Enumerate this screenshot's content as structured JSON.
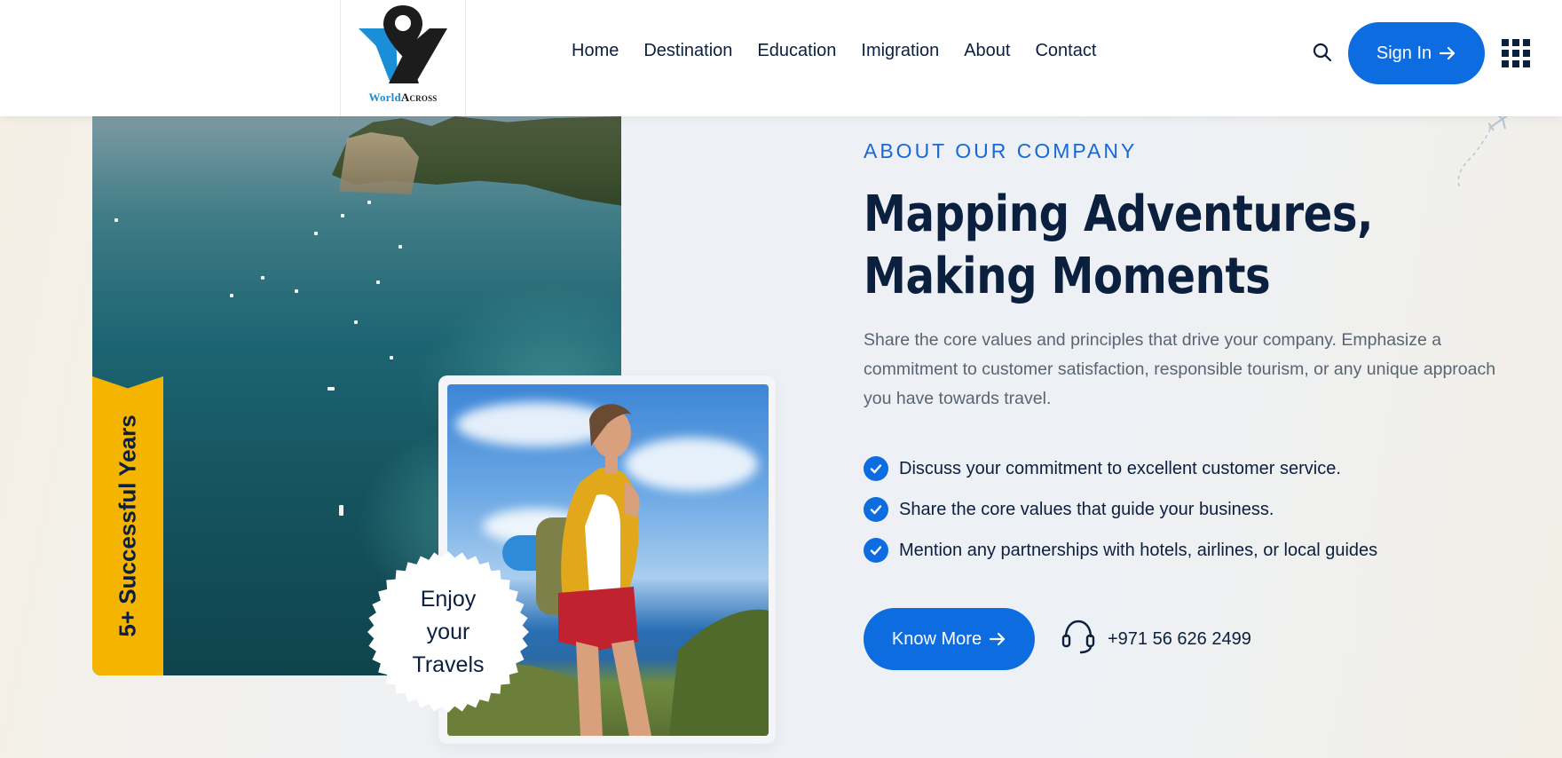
{
  "header": {
    "logo": {
      "word1": "World",
      "word2": "Across"
    },
    "nav": [
      {
        "label": "Home"
      },
      {
        "label": "Destination"
      },
      {
        "label": "Education"
      },
      {
        "label": "Imigration"
      },
      {
        "label": "About"
      },
      {
        "label": "Contact"
      }
    ],
    "sign_in_label": "Sign In",
    "icons": {
      "search": "search-icon",
      "menu": "grid-menu-icon",
      "arrow": "arrow-right-icon"
    }
  },
  "hero": {
    "years_badge": "5+ Successful Years",
    "stamp": [
      "Enjoy",
      "your",
      "Travels"
    ]
  },
  "about": {
    "eyebrow": "ABOUT OUR COMPANY",
    "headline": "Mapping Adventures, Making Moments",
    "description": "Share the core values and principles that drive your company. Emphasize a commitment to customer satisfaction, responsible tourism, or any unique approach you have towards travel.",
    "checklist": [
      "Discuss your commitment to excellent customer service.",
      "Share the core values that guide your business.",
      "Mention any partnerships with hotels, airlines, or local guides"
    ],
    "cta_label": "Know More",
    "phone": "+971 56 626 2499"
  },
  "colors": {
    "primary": "#0d6de0",
    "navy": "#0b1f3f",
    "badge": "#f5b400",
    "logo_blue": "#1a8fd8"
  }
}
